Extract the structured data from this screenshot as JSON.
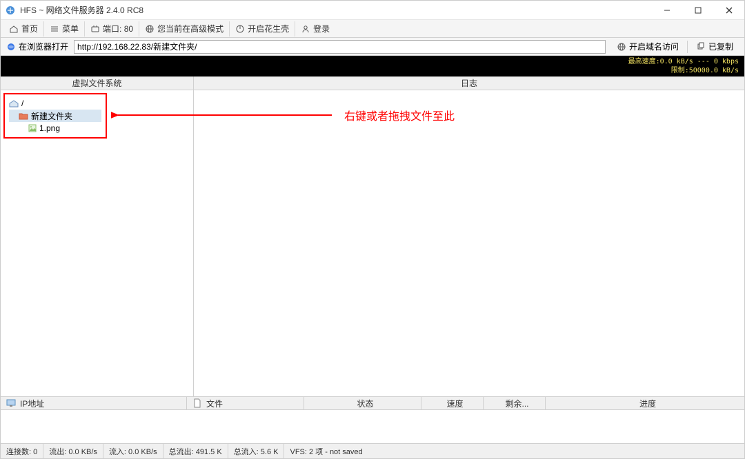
{
  "window": {
    "title": "HFS ~ 网络文件服务器 2.4.0 RC8"
  },
  "toolbar": {
    "home": "首页",
    "menu": "菜单",
    "port_label": "端口: 80",
    "mode": "您当前在高级模式",
    "peanut": "开启花生壳",
    "login": "登录"
  },
  "addrbar": {
    "open_label": "在浏览器打开",
    "url": "http://192.168.22.83/新建文件夹/",
    "dyndns": "开启域名访问",
    "copied": "已复制"
  },
  "speedband": {
    "line1": "最高速度:0.0 kB/s --- 0 kbps",
    "line2": "限制:50000.0 kB/s"
  },
  "headers": {
    "vfs": "虚拟文件系统",
    "log": "日志"
  },
  "tree": {
    "root": "/",
    "folder": "新建文件夹",
    "file": "1.png"
  },
  "annotation": {
    "text": "右键或者拖拽文件至此"
  },
  "conn_headers": {
    "ip": "IP地址",
    "file": "文件",
    "status": "状态",
    "speed": "速度",
    "remain": "剩余...",
    "progress": "进度"
  },
  "statusbar": {
    "connections": "连接数: 0",
    "out": "流出: 0.0 KB/s",
    "in": "流入: 0.0 KB/s",
    "total_out": "总流出: 491.5 K",
    "total_in": "总流入: 5.6 K",
    "vfs": "VFS: 2 项 - not saved"
  }
}
